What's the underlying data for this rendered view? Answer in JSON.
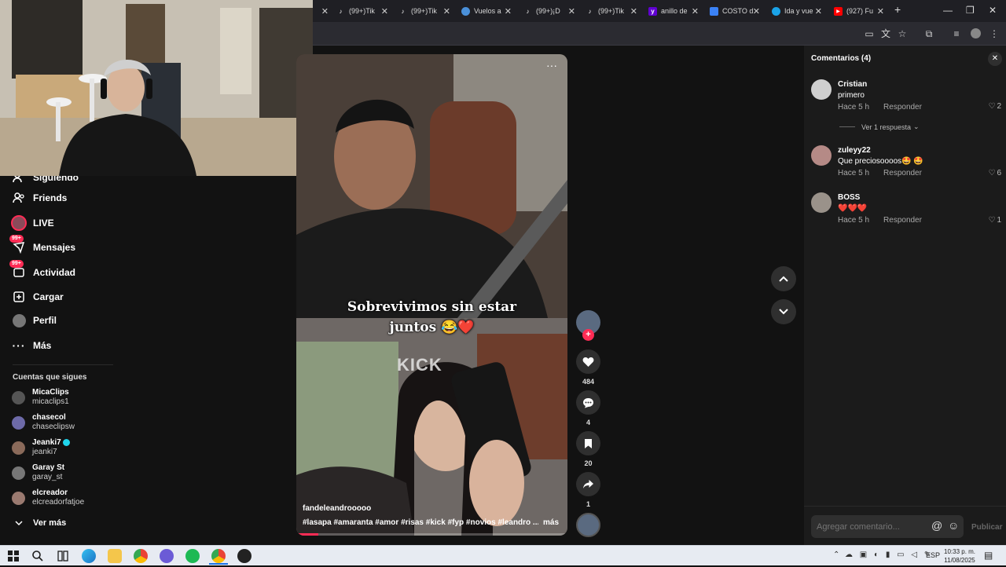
{
  "browser": {
    "tabs": [
      {
        "label": "(99+)Tik",
        "icon": "tiktok-icon"
      },
      {
        "label": "(99+)Tik",
        "icon": "tiktok-icon"
      },
      {
        "label": "Vuelos a",
        "icon": "globe-icon"
      },
      {
        "label": "(99+)¡D",
        "icon": "tiktok-icon"
      },
      {
        "label": "(99+)Tik",
        "icon": "tiktok-icon"
      },
      {
        "label": "anillo de",
        "icon": "yahoo-icon"
      },
      {
        "label": "COSTO d",
        "icon": "puzzle-icon"
      },
      {
        "label": "Ida y vue",
        "icon": "kayak-icon"
      },
      {
        "label": "(927) Fu",
        "icon": "youtube-icon"
      }
    ],
    "new_tab": "+",
    "win_min": "—",
    "win_restore": "❐",
    "win_close": "✕"
  },
  "sidebar": {
    "partial_item": "Siguiendo",
    "items": [
      {
        "label": "Friends",
        "icon": "friends-icon"
      },
      {
        "label": "LIVE",
        "icon": "live-icon"
      },
      {
        "label": "Mensajes",
        "icon": "messages-icon",
        "badge": "99+"
      },
      {
        "label": "Actividad",
        "icon": "activity-icon",
        "badge": "99+"
      },
      {
        "label": "Cargar",
        "icon": "upload-icon"
      },
      {
        "label": "Perfil",
        "icon": "profile-icon"
      },
      {
        "label": "Más",
        "icon": "more-icon"
      }
    ],
    "following_title": "Cuentas que sigues",
    "accounts": [
      {
        "name": "MicaClips",
        "handle": "micaclips1",
        "verified": false
      },
      {
        "name": "chasecol",
        "handle": "chaseclipsw",
        "verified": false
      },
      {
        "name": "Jeanki7",
        "handle": "jeanki7",
        "verified": true
      },
      {
        "name": "Garay St",
        "handle": "garay_st",
        "verified": false
      },
      {
        "name": "elcreador",
        "handle": "elcreadorfatjoe",
        "verified": false
      }
    ],
    "see_more": "Ver más"
  },
  "video": {
    "caption_line1": "Sobrevivimos sin estar",
    "caption_line2": "juntos 😂❤️",
    "watermark": "KICK",
    "author": "fandeleandrooooo",
    "hashtags": "#lasapa  #amaranta  #amor  #risas  #kick  #fyp  #novios  #leandro ...",
    "more": "más",
    "progress": 0.08
  },
  "actions": {
    "likes": "484",
    "comments": "4",
    "saves": "20",
    "shares": "1"
  },
  "comments_panel": {
    "title": "Comentarios (4)",
    "comments": [
      {
        "user": "Cristian",
        "text": "primero",
        "time": "Hace 5 h",
        "reply": "Responder",
        "likes": "2"
      },
      {
        "user": "zuleyy22",
        "text": "Que preciosoooos🤩 🤩",
        "time": "Hace 5 h",
        "reply": "Responder",
        "likes": "6"
      },
      {
        "user": "BOSS",
        "text": "❤️❤️❤️",
        "time": "Hace 5 h",
        "reply": "Responder",
        "likes": "1"
      }
    ],
    "view_replies": "Ver 1 respuesta",
    "input_placeholder": "Agregar comentario...",
    "publish": "Publicar"
  },
  "taskbar": {
    "lang": "ESP",
    "time": "10:33 p. m.",
    "date": "11/08/2025"
  },
  "colors": {
    "accent": "#fe2c55",
    "bg": "#121212",
    "panel": "#1b1b1b"
  }
}
